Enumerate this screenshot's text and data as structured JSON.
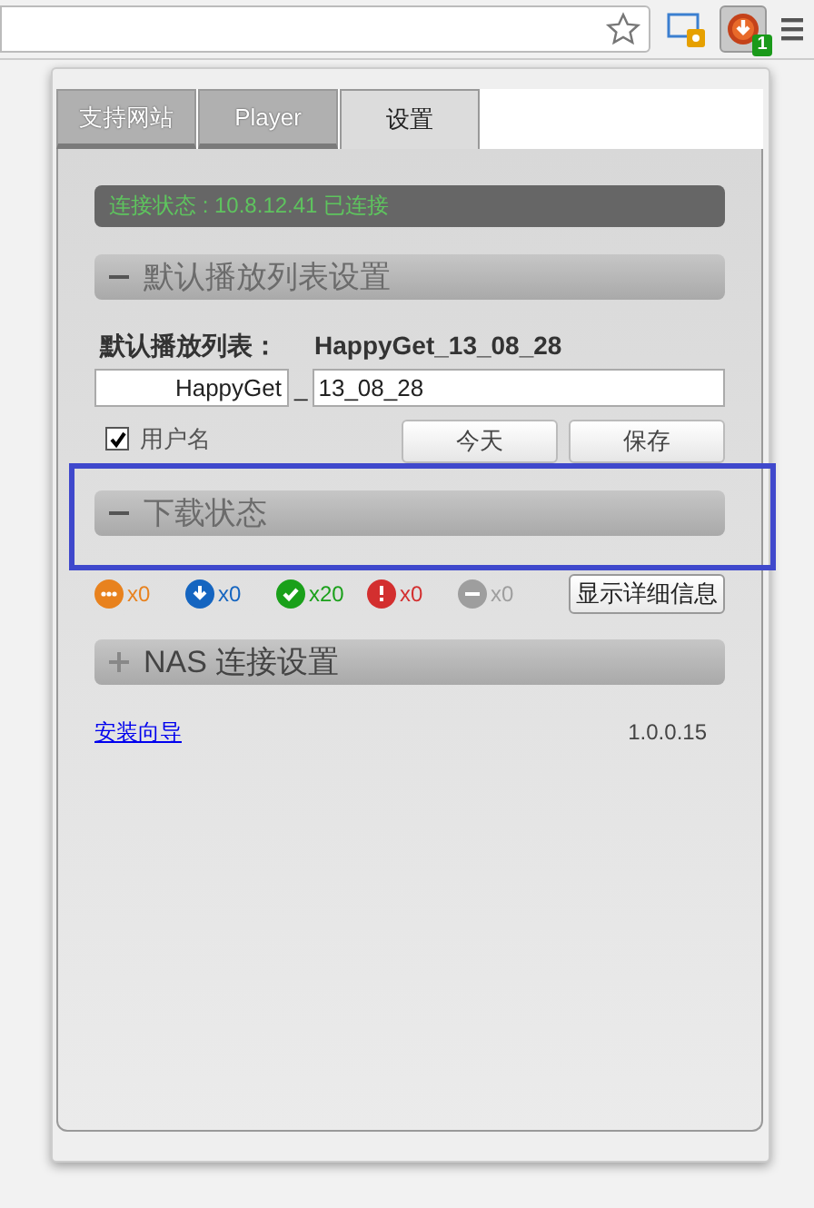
{
  "toolbar": {
    "extension_badge": "1"
  },
  "tabs": [
    {
      "label": "支持网站",
      "selected": false
    },
    {
      "label": "Player",
      "selected": false
    },
    {
      "label": "设置",
      "selected": true
    }
  ],
  "connection_status": "连接状态 : 10.8.12.41 已连接",
  "playlist_section": {
    "title": "默认播放列表设置",
    "expanded": true,
    "label": "默认播放列表：",
    "preview": "HappyGet_13_08_28",
    "prefix_value": "HappyGet",
    "separator": "_",
    "suffix_value": "13_08_28",
    "checkbox": {
      "label": "用户名",
      "checked": true
    },
    "buttons": [
      "今天",
      "保存"
    ]
  },
  "download_section": {
    "title": "下载状态",
    "expanded": true,
    "counters": [
      {
        "kind": "waiting",
        "color": "#e8821e",
        "count": "x0"
      },
      {
        "kind": "downloading",
        "color": "#1565c0",
        "count": "x0"
      },
      {
        "kind": "done",
        "color": "#1aa01a",
        "count": "x20"
      },
      {
        "kind": "error",
        "color": "#d32f2f",
        "count": "x0"
      },
      {
        "kind": "stopped",
        "color": "#9e9e9e",
        "count": "x0"
      }
    ],
    "details_button": "显示详细信息"
  },
  "nas_section": {
    "title": "NAS 连接设置",
    "expanded": false
  },
  "footer": {
    "link": "安装向导",
    "version": "1.0.0.15"
  }
}
